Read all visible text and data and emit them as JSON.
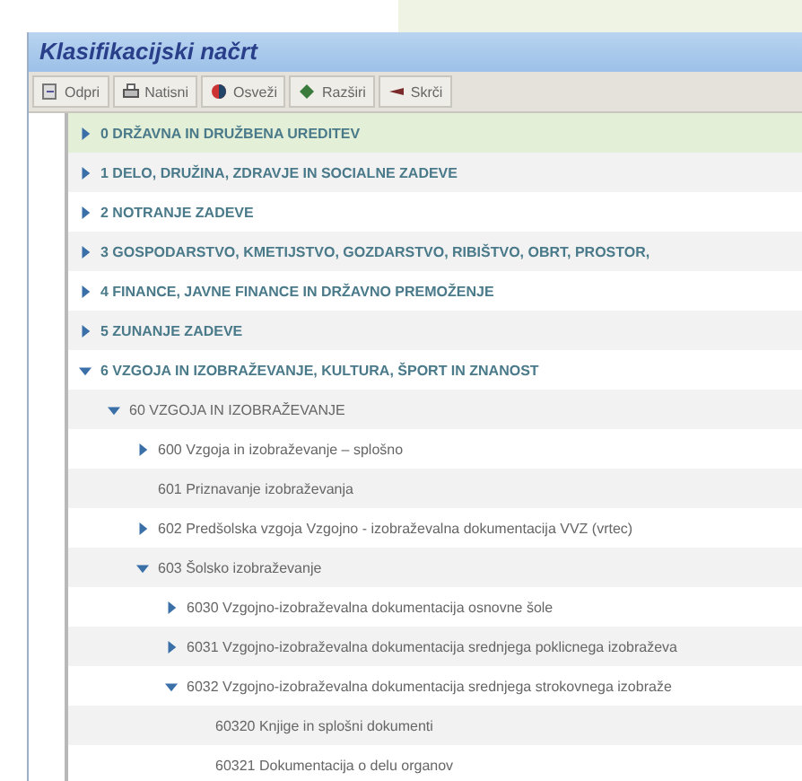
{
  "window": {
    "title": "Klasifikacijski načrt"
  },
  "toolbar": [
    {
      "label": "Odpri",
      "kind": "open"
    },
    {
      "label": "Natisni",
      "kind": "print"
    },
    {
      "label": "Osveži",
      "kind": "refresh"
    },
    {
      "label": "Razširi",
      "kind": "expand"
    },
    {
      "label": "Skrči",
      "kind": "collapse"
    }
  ],
  "tree": [
    {
      "label": "0 DRŽAVNA IN DRUŽBENA UREDITEV",
      "expanded": false,
      "selected": true
    },
    {
      "label": "1 DELO, DRUŽINA, ZDRAVJE IN SOCIALNE ZADEVE",
      "expanded": false,
      "selected": false
    },
    {
      "label": "2 NOTRANJE ZADEVE",
      "expanded": false,
      "selected": false
    },
    {
      "label": "3 GOSPODARSTVO, KMETIJSTVO, GOZDARSTVO, RIBIŠTVO, OBRT, PROSTOR,",
      "expanded": false,
      "selected": false
    },
    {
      "label": "4 FINANCE, JAVNE FINANCE IN DRŽAVNO PREMOŽENJE",
      "expanded": false,
      "selected": false
    },
    {
      "label": "5 ZUNANJE ZADEVE",
      "expanded": false,
      "selected": false
    },
    {
      "label": "6 VZGOJA IN IZOBRAŽEVANJE, KULTURA, ŠPORT IN ZNANOST",
      "expanded": true,
      "selected": false,
      "children": [
        {
          "label": "60 VZGOJA IN IZOBRAŽEVANJE",
          "expanded": true,
          "selected": false,
          "children": [
            {
              "label": "600 Vzgoja in izobraževanje – splošno",
              "expanded": false,
              "selected": false
            },
            {
              "label": "601 Priznavanje izobraževanja",
              "selected": false
            },
            {
              "label": "602 Predšolska vzgoja Vzgojno - izobraževalna dokumentacija VVZ (vrtec)",
              "expanded": false,
              "selected": false
            },
            {
              "label": "603 Šolsko izobraževanje",
              "expanded": true,
              "selected": false,
              "children": [
                {
                  "label": "6030 Vzgojno-izobraževalna dokumentacija osnovne šole",
                  "expanded": false,
                  "selected": false
                },
                {
                  "label": "6031 Vzgojno-izobraževalna dokumentacija srednjega poklicnega izobraževa",
                  "expanded": false,
                  "selected": false
                },
                {
                  "label": "6032 Vzgojno-izobraževalna dokumentacija srednjega strokovnega izobraže",
                  "expanded": true,
                  "selected": false,
                  "children": [
                    {
                      "label": "60320 Knjige in splošni dokumenti",
                      "selected": false
                    },
                    {
                      "label": "60321 Dokumentacija o delu organov",
                      "selected": false
                    }
                  ]
                }
              ]
            }
          ]
        }
      ]
    }
  ]
}
